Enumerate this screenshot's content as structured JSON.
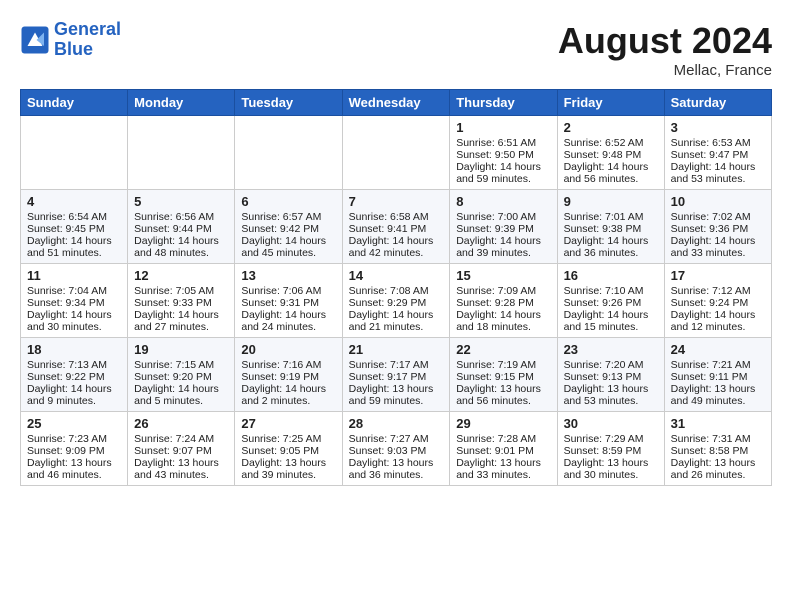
{
  "header": {
    "logo_line1": "General",
    "logo_line2": "Blue",
    "month_year": "August 2024",
    "location": "Mellac, France"
  },
  "days_of_week": [
    "Sunday",
    "Monday",
    "Tuesday",
    "Wednesday",
    "Thursday",
    "Friday",
    "Saturday"
  ],
  "weeks": [
    [
      {
        "day": "",
        "sunrise": "",
        "sunset": "",
        "daylight": ""
      },
      {
        "day": "",
        "sunrise": "",
        "sunset": "",
        "daylight": ""
      },
      {
        "day": "",
        "sunrise": "",
        "sunset": "",
        "daylight": ""
      },
      {
        "day": "",
        "sunrise": "",
        "sunset": "",
        "daylight": ""
      },
      {
        "day": "1",
        "sunrise": "6:51 AM",
        "sunset": "9:50 PM",
        "daylight": "14 hours and 59 minutes."
      },
      {
        "day": "2",
        "sunrise": "6:52 AM",
        "sunset": "9:48 PM",
        "daylight": "14 hours and 56 minutes."
      },
      {
        "day": "3",
        "sunrise": "6:53 AM",
        "sunset": "9:47 PM",
        "daylight": "14 hours and 53 minutes."
      }
    ],
    [
      {
        "day": "4",
        "sunrise": "6:54 AM",
        "sunset": "9:45 PM",
        "daylight": "14 hours and 51 minutes."
      },
      {
        "day": "5",
        "sunrise": "6:56 AM",
        "sunset": "9:44 PM",
        "daylight": "14 hours and 48 minutes."
      },
      {
        "day": "6",
        "sunrise": "6:57 AM",
        "sunset": "9:42 PM",
        "daylight": "14 hours and 45 minutes."
      },
      {
        "day": "7",
        "sunrise": "6:58 AM",
        "sunset": "9:41 PM",
        "daylight": "14 hours and 42 minutes."
      },
      {
        "day": "8",
        "sunrise": "7:00 AM",
        "sunset": "9:39 PM",
        "daylight": "14 hours and 39 minutes."
      },
      {
        "day": "9",
        "sunrise": "7:01 AM",
        "sunset": "9:38 PM",
        "daylight": "14 hours and 36 minutes."
      },
      {
        "day": "10",
        "sunrise": "7:02 AM",
        "sunset": "9:36 PM",
        "daylight": "14 hours and 33 minutes."
      }
    ],
    [
      {
        "day": "11",
        "sunrise": "7:04 AM",
        "sunset": "9:34 PM",
        "daylight": "14 hours and 30 minutes."
      },
      {
        "day": "12",
        "sunrise": "7:05 AM",
        "sunset": "9:33 PM",
        "daylight": "14 hours and 27 minutes."
      },
      {
        "day": "13",
        "sunrise": "7:06 AM",
        "sunset": "9:31 PM",
        "daylight": "14 hours and 24 minutes."
      },
      {
        "day": "14",
        "sunrise": "7:08 AM",
        "sunset": "9:29 PM",
        "daylight": "14 hours and 21 minutes."
      },
      {
        "day": "15",
        "sunrise": "7:09 AM",
        "sunset": "9:28 PM",
        "daylight": "14 hours and 18 minutes."
      },
      {
        "day": "16",
        "sunrise": "7:10 AM",
        "sunset": "9:26 PM",
        "daylight": "14 hours and 15 minutes."
      },
      {
        "day": "17",
        "sunrise": "7:12 AM",
        "sunset": "9:24 PM",
        "daylight": "14 hours and 12 minutes."
      }
    ],
    [
      {
        "day": "18",
        "sunrise": "7:13 AM",
        "sunset": "9:22 PM",
        "daylight": "14 hours and 9 minutes."
      },
      {
        "day": "19",
        "sunrise": "7:15 AM",
        "sunset": "9:20 PM",
        "daylight": "14 hours and 5 minutes."
      },
      {
        "day": "20",
        "sunrise": "7:16 AM",
        "sunset": "9:19 PM",
        "daylight": "14 hours and 2 minutes."
      },
      {
        "day": "21",
        "sunrise": "7:17 AM",
        "sunset": "9:17 PM",
        "daylight": "13 hours and 59 minutes."
      },
      {
        "day": "22",
        "sunrise": "7:19 AM",
        "sunset": "9:15 PM",
        "daylight": "13 hours and 56 minutes."
      },
      {
        "day": "23",
        "sunrise": "7:20 AM",
        "sunset": "9:13 PM",
        "daylight": "13 hours and 53 minutes."
      },
      {
        "day": "24",
        "sunrise": "7:21 AM",
        "sunset": "9:11 PM",
        "daylight": "13 hours and 49 minutes."
      }
    ],
    [
      {
        "day": "25",
        "sunrise": "7:23 AM",
        "sunset": "9:09 PM",
        "daylight": "13 hours and 46 minutes."
      },
      {
        "day": "26",
        "sunrise": "7:24 AM",
        "sunset": "9:07 PM",
        "daylight": "13 hours and 43 minutes."
      },
      {
        "day": "27",
        "sunrise": "7:25 AM",
        "sunset": "9:05 PM",
        "daylight": "13 hours and 39 minutes."
      },
      {
        "day": "28",
        "sunrise": "7:27 AM",
        "sunset": "9:03 PM",
        "daylight": "13 hours and 36 minutes."
      },
      {
        "day": "29",
        "sunrise": "7:28 AM",
        "sunset": "9:01 PM",
        "daylight": "13 hours and 33 minutes."
      },
      {
        "day": "30",
        "sunrise": "7:29 AM",
        "sunset": "8:59 PM",
        "daylight": "13 hours and 30 minutes."
      },
      {
        "day": "31",
        "sunrise": "7:31 AM",
        "sunset": "8:58 PM",
        "daylight": "13 hours and 26 minutes."
      }
    ]
  ]
}
